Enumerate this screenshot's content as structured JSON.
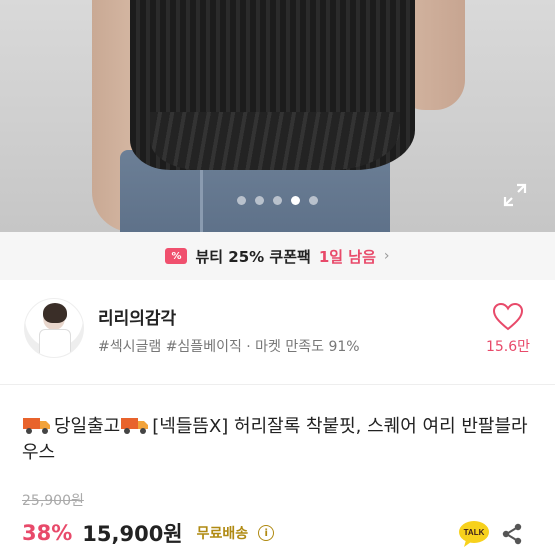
{
  "gallery": {
    "dots": [
      false,
      false,
      false,
      true,
      false
    ],
    "expand_icon": "expand-arrows-icon"
  },
  "coupon": {
    "icon_text": "%",
    "text": "뷰티 25% 쿠폰팩",
    "remaining": "1일 남음",
    "arrow": "›"
  },
  "seller": {
    "name": "리리의감각",
    "tags": "#섹시글램 #심플베이직 · 마켓 만족도 91%",
    "likes": "15.6만"
  },
  "product": {
    "title_part1": "당일출고",
    "title_part2": "[넥들뜸X] 허리잘록 착붙핏, 스퀘어 여리 반팔블라우스",
    "original_price": "25,900원",
    "discount": "38%",
    "price": "15,900원",
    "shipping": "무료배송",
    "info_icon": "i",
    "talk_label": "TALK"
  },
  "colors": {
    "accent": "#e84a6a",
    "shipping": "#b08a12"
  }
}
